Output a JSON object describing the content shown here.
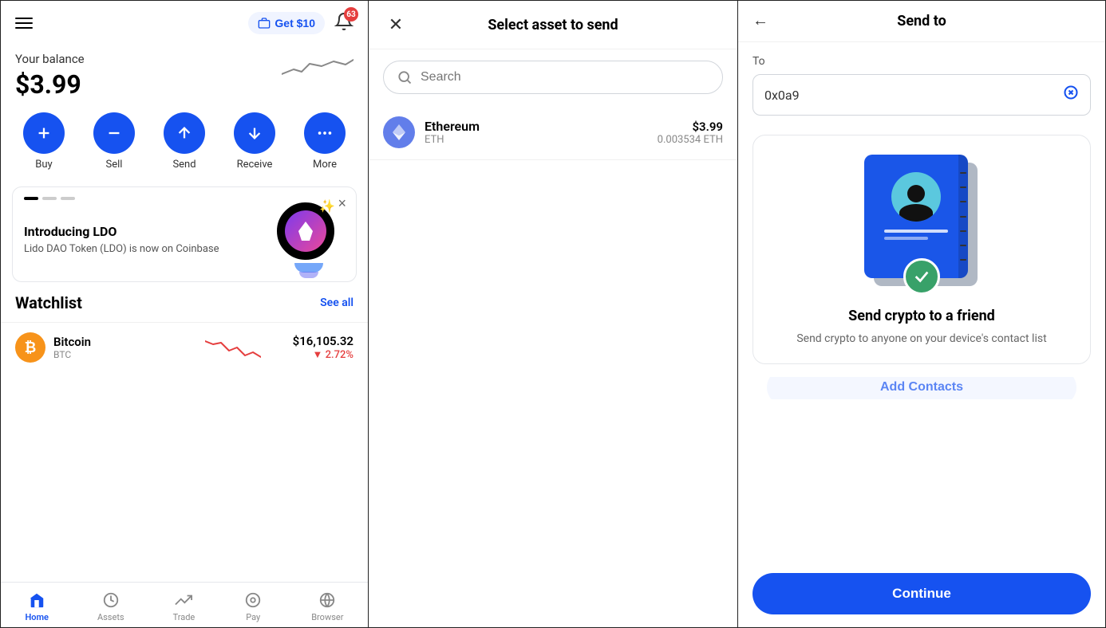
{
  "left": {
    "get_btn": "Get $10",
    "bell_count": "63",
    "balance_label": "Your balance",
    "balance_amount": "$3.99",
    "actions": [
      {
        "label": "Buy",
        "icon": "plus"
      },
      {
        "label": "Sell",
        "icon": "minus"
      },
      {
        "label": "Send",
        "icon": "arrow-up"
      },
      {
        "label": "Receive",
        "icon": "arrow-down"
      },
      {
        "label": "More",
        "icon": "ellipsis"
      }
    ],
    "promo": {
      "title": "Introducing LDO",
      "desc": "Lido DAO Token (LDO) is now on Coinbase"
    },
    "watchlist": {
      "title": "Watchlist",
      "see_all": "See all",
      "items": [
        {
          "name": "Bitcoin",
          "symbol": "BTC",
          "price": "$16,105.32",
          "change": "▼ 2.72%"
        }
      ]
    },
    "nav": [
      {
        "label": "Home",
        "active": true
      },
      {
        "label": "Assets",
        "active": false
      },
      {
        "label": "Trade",
        "active": false
      },
      {
        "label": "Pay",
        "active": false
      },
      {
        "label": "Browser",
        "active": false
      }
    ]
  },
  "middle": {
    "title": "Select asset to send",
    "search_placeholder": "Search",
    "asset": {
      "name": "Ethereum",
      "symbol": "ETH",
      "usd_value": "$3.99",
      "crypto_value": "0.003534 ETH"
    }
  },
  "right": {
    "title": "Send to",
    "to_label": "To",
    "to_value": "0x0a9",
    "card_title": "Send crypto to a friend",
    "card_desc": "Send crypto to anyone on your device's contact list",
    "continue_btn": "Continue",
    "add_contacts_btn": "Add Contacts"
  }
}
